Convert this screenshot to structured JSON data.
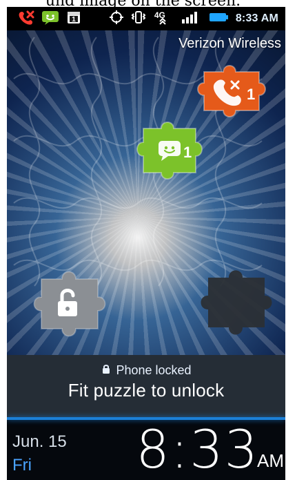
{
  "caption": {
    "text": "und image on the screen."
  },
  "status_bar": {
    "network_label": "4G",
    "time": "8:33 AM"
  },
  "lockscreen": {
    "carrier": "Verizon Wireless",
    "missed_calls_count": "1",
    "messages_count": "1",
    "phone_locked": "Phone locked",
    "instruction": "Fit puzzle to unlock",
    "date": "Jun. 15",
    "day": "Fri",
    "clock_time": "8:33",
    "ampm": "AM"
  },
  "colors": {
    "accent_blue": "#1b7fd7",
    "missed_calls_orange": "#e55a1a",
    "messages_green": "#7cc22a",
    "unlock_gray": "#8b8f94",
    "target_dark": "#2b2f35"
  }
}
